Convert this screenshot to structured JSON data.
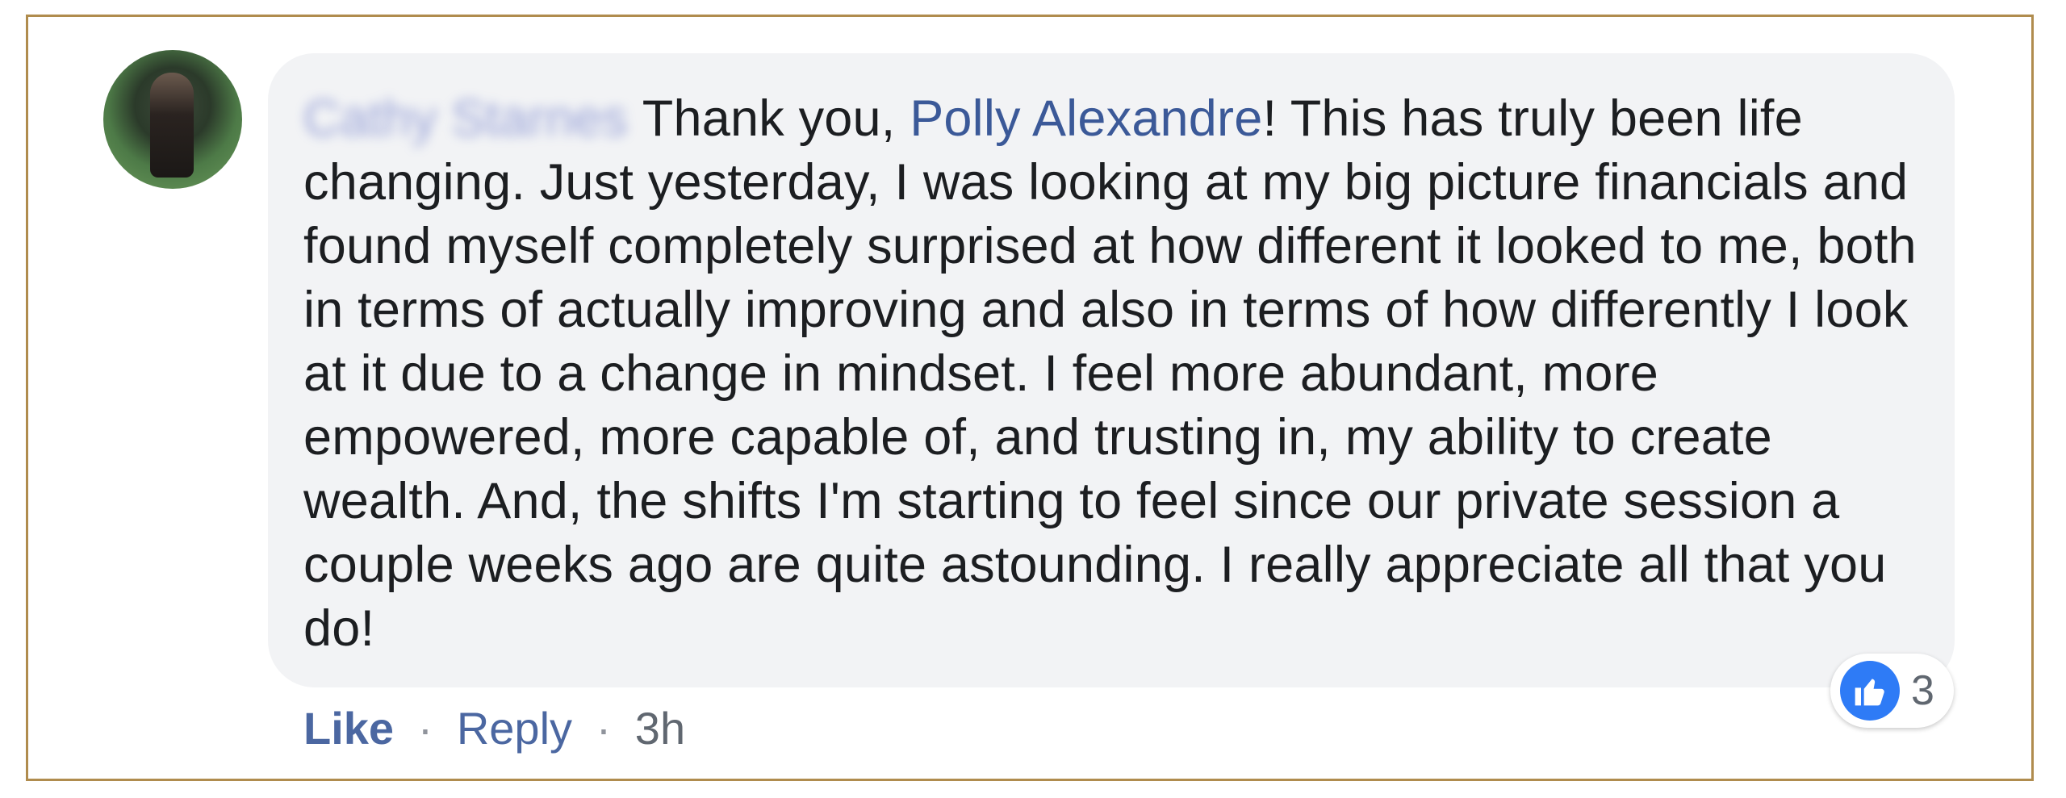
{
  "comment": {
    "author": "Cathy Starnes",
    "text_before_mention": "Thank you, ",
    "mention": "Polly Alexandre",
    "text_after_mention": "! This has truly been life changing. Just yesterday, I was looking at my big picture financials and found myself completely surprised at how different it looked to me, both in terms of actually improving and also in terms of how differently I look at it due to a change in mindset. I feel more abundant, more empowered, more capable of, and trusting in, my ability to create wealth. And, the shifts I'm starting to feel since our private session a couple weeks ago are quite astounding. I really appreciate all that you do!",
    "reaction_icon": "thumbs-up-icon",
    "reaction_count": "3"
  },
  "actions": {
    "like_label": "Like",
    "separator": "·",
    "reply_label": "Reply",
    "timestamp": "3h"
  },
  "colors": {
    "frame_border": "#b08c4e",
    "bubble_background": "#f2f3f5",
    "mention": "#3b5998",
    "like_badge": "#2e7bf6"
  }
}
